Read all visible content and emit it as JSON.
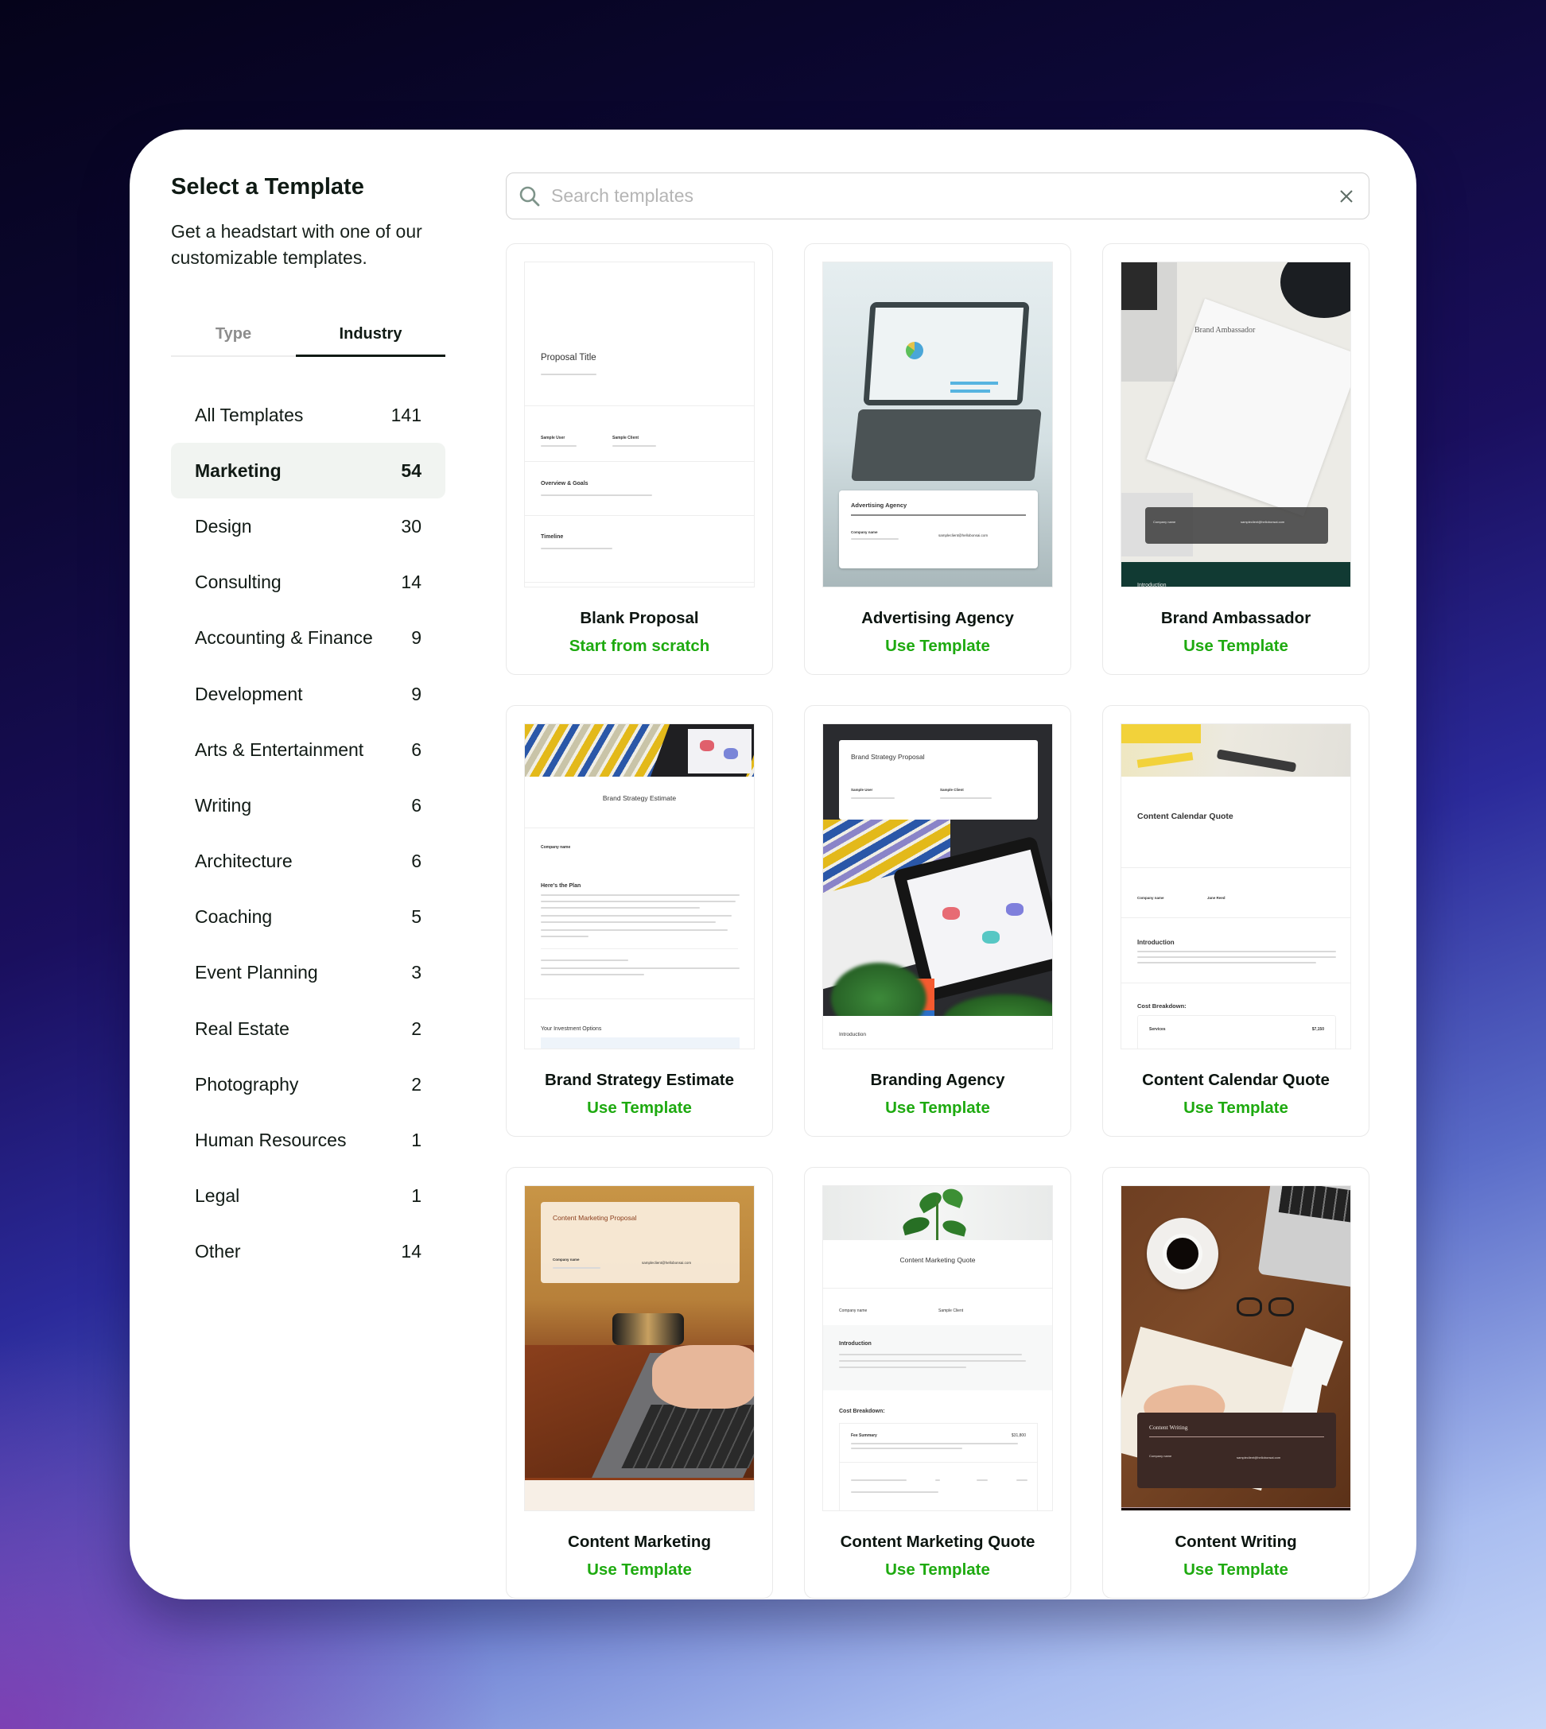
{
  "header": {
    "title": "Select a Template",
    "subtitle": "Get a headstart with one of our customizable templates."
  },
  "tabs": [
    {
      "label": "Type",
      "active": false
    },
    {
      "label": "Industry",
      "active": true
    }
  ],
  "categories": [
    {
      "label": "All Templates",
      "count": "141",
      "active": false
    },
    {
      "label": "Marketing",
      "count": "54",
      "active": true
    },
    {
      "label": "Design",
      "count": "30",
      "active": false
    },
    {
      "label": "Consulting",
      "count": "14",
      "active": false
    },
    {
      "label": "Accounting & Finance",
      "count": "9",
      "active": false
    },
    {
      "label": "Development",
      "count": "9",
      "active": false
    },
    {
      "label": "Arts & Entertainment",
      "count": "6",
      "active": false
    },
    {
      "label": "Writing",
      "count": "6",
      "active": false
    },
    {
      "label": "Architecture",
      "count": "6",
      "active": false
    },
    {
      "label": "Coaching",
      "count": "5",
      "active": false
    },
    {
      "label": "Event Planning",
      "count": "3",
      "active": false
    },
    {
      "label": "Real Estate",
      "count": "2",
      "active": false
    },
    {
      "label": "Photography",
      "count": "2",
      "active": false
    },
    {
      "label": "Human Resources",
      "count": "1",
      "active": false
    },
    {
      "label": "Legal",
      "count": "1",
      "active": false
    },
    {
      "label": "Other",
      "count": "14",
      "active": false
    }
  ],
  "search": {
    "placeholder": "Search templates",
    "value": "",
    "icon": "search-icon",
    "clear_icon": "close-icon"
  },
  "templates": [
    {
      "name": "Blank Proposal",
      "action": "Start from scratch",
      "preview": {
        "title": "Proposal Title",
        "sections": [
          "Overview & Goals",
          "Timeline"
        ],
        "from": "Sample User",
        "to": "Sample Client"
      }
    },
    {
      "name": "Advertising Agency",
      "action": "Use Template",
      "preview": {
        "title": "Advertising Agency",
        "from": "Company name",
        "to": "sampleclient@hellobonsai.com"
      }
    },
    {
      "name": "Brand Ambassador",
      "action": "Use Template",
      "preview": {
        "title": "Brand Ambassador",
        "from": "Company name",
        "to": "sampleclient@hellobonsai.com",
        "footer": "Introduction"
      }
    },
    {
      "name": "Brand Strategy Estimate",
      "action": "Use Template",
      "preview": {
        "title": "Brand Strategy Estimate",
        "from": "Company name",
        "sections": [
          "Here's the Plan",
          "Your Investment Options"
        ]
      }
    },
    {
      "name": "Branding Agency",
      "action": "Use Template",
      "preview": {
        "title": "Brand Strategy Proposal",
        "from": "Sample User",
        "to": "Sample Client",
        "footer": "Introduction"
      }
    },
    {
      "name": "Content Calendar Quote",
      "action": "Use Template",
      "preview": {
        "title": "Content Calendar Quote",
        "from": "Company name",
        "to": "Jane Reed",
        "sections": [
          "Introduction",
          "Cost Breakdown:"
        ],
        "services_label": "Services",
        "services_amount": "$7,150"
      }
    },
    {
      "name": "Content Marketing",
      "action": "Use Template",
      "preview": {
        "title": "Content Marketing Proposal",
        "from": "Company name",
        "to": "sampleclient@hellobonsai.com"
      }
    },
    {
      "name": "Content Marketing Quote",
      "action": "Use Template",
      "preview": {
        "title": "Content Marketing Quote",
        "from": "Company name",
        "to": "Sample Client",
        "sections": [
          "Introduction",
          "Cost Breakdown:"
        ],
        "fee_label": "Fee Summary",
        "fee_amount": "$31,800"
      }
    },
    {
      "name": "Content Writing",
      "action": "Use Template",
      "preview": {
        "title": "Content Writing",
        "from": "Company name",
        "to": "sampleclient@hellobonsai.com"
      }
    }
  ],
  "colors": {
    "accent_green": "#1eaa10",
    "active_category_bg": "#f1f4f1",
    "text_dark": "#0f1a14"
  }
}
